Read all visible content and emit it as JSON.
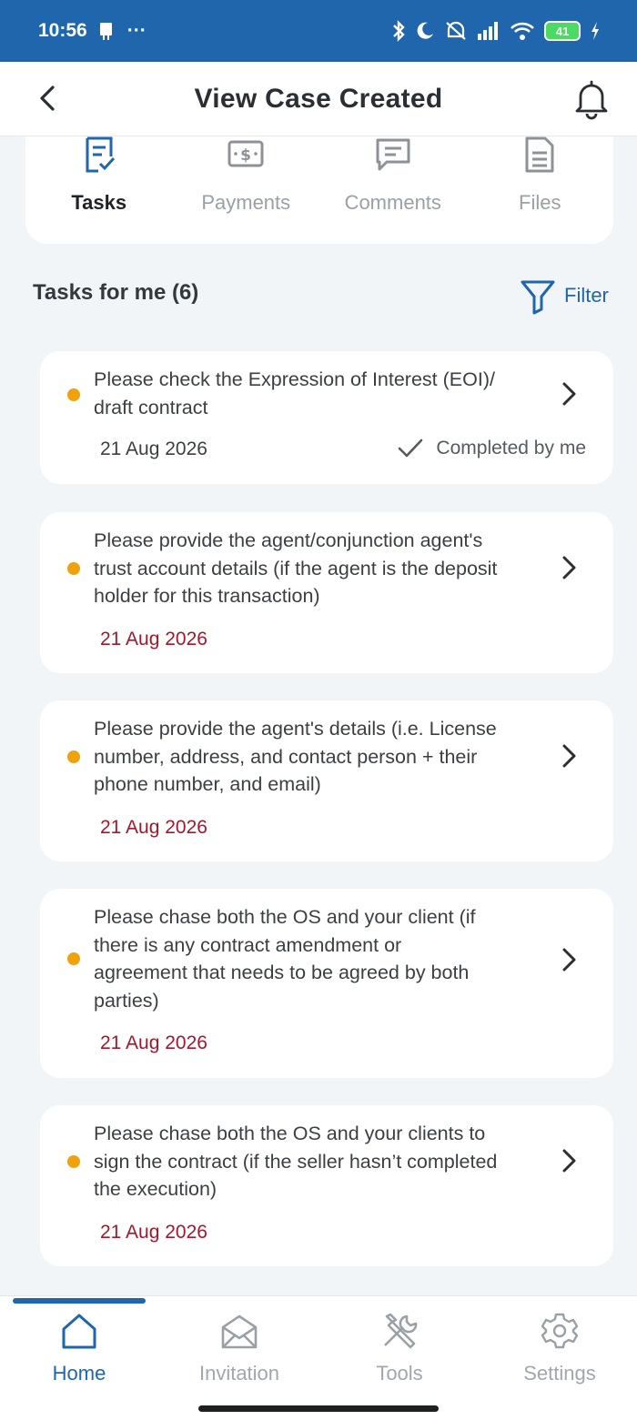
{
  "status_bar": {
    "time": "10:56",
    "dots": "···",
    "battery": "41"
  },
  "header": {
    "title": "View Case Created"
  },
  "tabs": [
    {
      "label": "Tasks",
      "icon": "tasks-icon",
      "active": true
    },
    {
      "label": "Payments",
      "icon": "payments-icon",
      "active": false
    },
    {
      "label": "Comments",
      "icon": "comments-icon",
      "active": false
    },
    {
      "label": "Files",
      "icon": "files-icon",
      "active": false
    }
  ],
  "section": {
    "title": "Tasks for me (6)",
    "filter_label": "Filter"
  },
  "tasks": [
    {
      "lines": [
        "Please check the Expression of Interest (EOI)/",
        "draft contract"
      ],
      "date": "21 Aug 2026",
      "status": "Completed by me"
    },
    {
      "lines": [
        "Please provide the agent/conjunction agent's",
        "trust account details (if the agent is the deposit",
        "holder for this transaction)"
      ],
      "date": "21 Aug 2026"
    },
    {
      "lines": [
        "Please provide the agent's details (i.e. License",
        "number, address, and contact person + their",
        "phone number, and email)"
      ],
      "date": "21 Aug 2026"
    },
    {
      "lines": [
        "Please chase both the OS and your client (if",
        "there is any contract amendment or",
        "agreement that needs to be agreed by both",
        "parties)"
      ],
      "date": "21 Aug 2026"
    },
    {
      "lines": [
        "Please chase both the OS and your clients to",
        "sign the contract (if the seller hasn’t completed",
        "the execution)"
      ],
      "date": "21 Aug 2026"
    }
  ],
  "colors": {
    "brand": "#1f66ad",
    "dot": "#f0a20c",
    "due_date": "#a4172b"
  },
  "bottom_nav": [
    {
      "label": "Home",
      "icon": "home-icon",
      "active": true
    },
    {
      "label": "Invitation",
      "icon": "envelope-icon",
      "active": false
    },
    {
      "label": "Tools",
      "icon": "tools-icon",
      "active": false
    },
    {
      "label": "Settings",
      "icon": "gear-icon",
      "active": false
    }
  ]
}
